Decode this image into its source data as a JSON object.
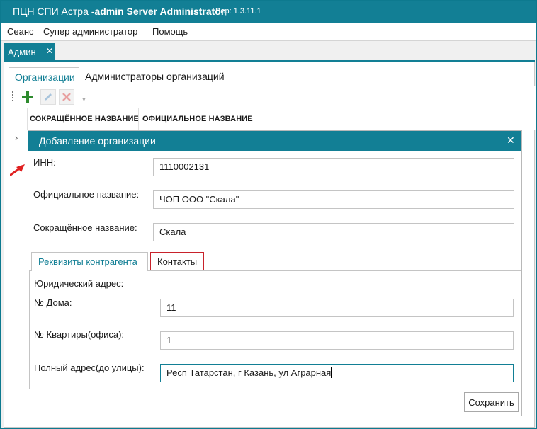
{
  "window": {
    "title_prefix": "ПЦН СПИ Астра -",
    "title_bold": "admin Server Administrator",
    "version": "Вер: 1.3.11.1"
  },
  "menu": [
    "Сеанс",
    "Супер администратор",
    "Помощь"
  ],
  "doc_tab": {
    "label": "Админ"
  },
  "subtabs": [
    "Организации",
    "Администраторы организаций"
  ],
  "toolbar": {
    "icons": [
      "add-icon",
      "edit-icon",
      "delete-icon"
    ]
  },
  "grid": {
    "columns": [
      "СОКРАЩЁННОЕ НАЗВАНИЕ",
      "ОФИЦИАЛЬНОЕ НАЗВАНИЕ"
    ]
  },
  "dialog": {
    "title": "Добавление организации",
    "inn": {
      "label": "ИНН:",
      "value": "1110002131"
    },
    "official_name": {
      "label": "Официальное название:",
      "value": "ЧОП ООО \"Скала\""
    },
    "short_name": {
      "label": "Сокращённое название:",
      "value": "Скала"
    },
    "tabs": [
      "Реквизиты контрагента",
      "Контакты"
    ],
    "legal_address_label": "Юридический адрес:",
    "house": {
      "label": "№ Дома:",
      "value": "11"
    },
    "apartment": {
      "label": "№ Квартиры(офиса):",
      "value": "1"
    },
    "full_address": {
      "label": "Полный адрес(до улицы):",
      "value": "Респ Татарстан, г Казань, ул Аграрная"
    },
    "save_label": "Сохранить"
  },
  "colors": {
    "accent": "#127f95",
    "error": "#c8222b",
    "add_green": "#2e8b2e",
    "arrow_red": "#e02020"
  }
}
